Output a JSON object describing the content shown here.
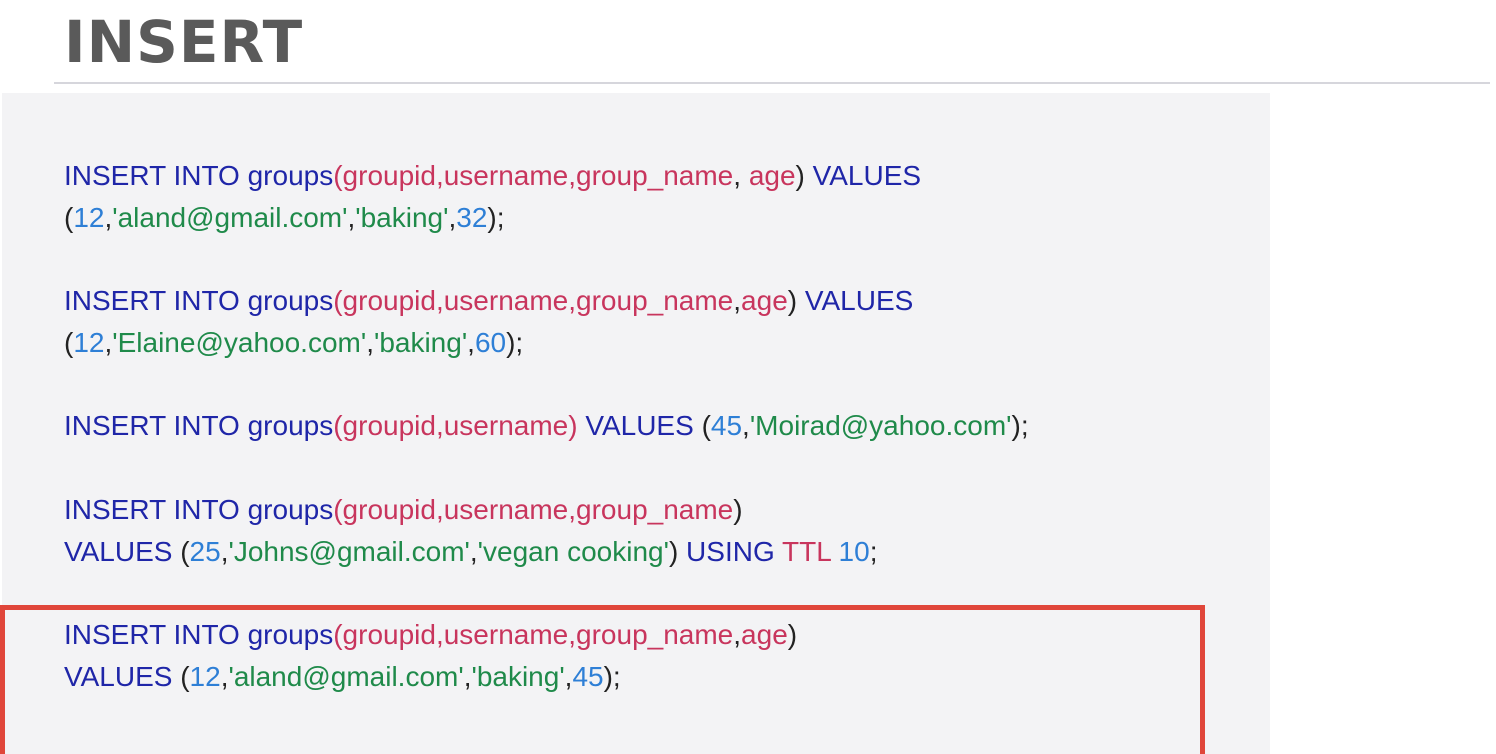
{
  "slide": {
    "title": "INSERT"
  },
  "statements": [
    {
      "line1": {
        "kw1": "INSERT INTO groups",
        "open": "(",
        "c1": "groupid",
        "s1": ",",
        "c2": "username",
        "s2": ",",
        "c3": "group_name",
        "s3": ", ",
        "c4": "age",
        "close": ")",
        "kw2": " VALUES"
      },
      "line2": {
        "open": "(",
        "v1": "12",
        "s1": ",",
        "v2": "'aland@gmail.com'",
        "s2": ",",
        "v3": "'baking'",
        "s3": ",",
        "v4": "32",
        "close": ");"
      }
    },
    {
      "line1": {
        "kw1": "INSERT INTO groups",
        "open": "(",
        "c1": "groupid",
        "s1": ",",
        "c2": "username",
        "s2": ",",
        "c3": "group_name",
        "s3": ",",
        "c4": "age",
        "close": ")",
        "kw2": " VALUES"
      },
      "line2": {
        "open": "(",
        "v1": "12",
        "s1": ",",
        "v2": "'Elaine@yahoo.com'",
        "s2": ",",
        "v3": "'baking'",
        "s3": ",",
        "v4": "60",
        "close": ");"
      }
    },
    {
      "line1": {
        "kw1": "INSERT INTO groups",
        "open": "(",
        "c1": "groupid",
        "s1": ",",
        "c2": "username",
        "close": ")",
        "kw2": " VALUES ",
        "vopen": "(",
        "v1": "45",
        "vs1": ",",
        "v2": "'Moirad@yahoo.com'",
        "vclose": ");"
      }
    },
    {
      "line1": {
        "kw1": "INSERT INTO groups",
        "open": "(",
        "c1": "groupid",
        "s1": ",",
        "c2": "username",
        "s2": ",",
        "c3": "group_name",
        "close": ")"
      },
      "line2": {
        "kw1": "VALUES ",
        "open": "(",
        "v1": "25",
        "s1": ",",
        "v2": "'Johns@gmail.com'",
        "s2": ",",
        "v3": "'vegan cooking'",
        "close": ")",
        "kw2": " USING ",
        "ttl": "TTL",
        "sp": " ",
        "v4": "10",
        "end": ";"
      }
    },
    {
      "line1": {
        "kw1": "INSERT INTO groups",
        "open": "(",
        "c1": "groupid",
        "s1": ",",
        "c2": "username",
        "s2": ",",
        "c3": "group_name",
        "s3": ",",
        "c4": "age",
        "close": ")"
      },
      "line2": {
        "kw1": "VALUES ",
        "open": "(",
        "v1": "12",
        "s1": ",",
        "v2": "'aland@gmail.com'",
        "s2": ",",
        "v3": "'baking'",
        "s3": ",",
        "v4": "45",
        "close": ");"
      }
    }
  ],
  "colors": {
    "keyword": "#1f26a8",
    "column": "#c8355d",
    "number": "#2e7fd6",
    "string": "#1f8a4a",
    "highlight": "#e0463a"
  }
}
